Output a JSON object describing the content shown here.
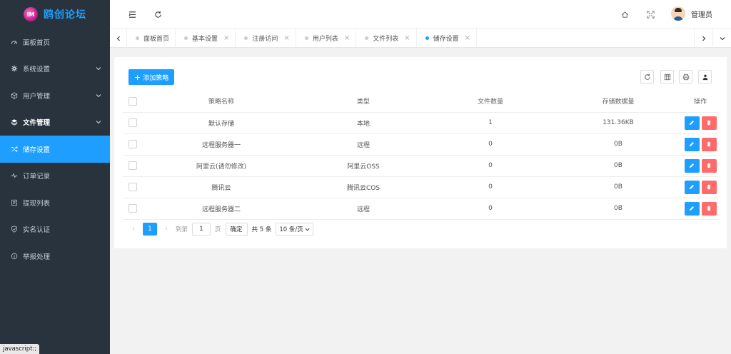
{
  "brand": {
    "name": "鸥创论坛",
    "mark": "IM"
  },
  "sidebar": {
    "items": [
      {
        "label": "面板首页",
        "icon": "dashboard-icon"
      },
      {
        "label": "系统设置",
        "icon": "gear-icon",
        "has_children": true
      },
      {
        "label": "用户管理",
        "icon": "cube-icon",
        "has_children": true
      },
      {
        "label": "文件管理",
        "icon": "layers-icon",
        "has_children": true
      },
      {
        "label": "储存设置",
        "icon": "shuffle-icon"
      },
      {
        "label": "订单记录",
        "icon": "pulse-icon"
      },
      {
        "label": "提现列表",
        "icon": "list-icon"
      },
      {
        "label": "实名认证",
        "icon": "shield-icon"
      },
      {
        "label": "举报处理",
        "icon": "info-icon"
      }
    ]
  },
  "status_bar": {
    "text": "javascript:;"
  },
  "header": {
    "user_name": "管理员"
  },
  "tabs": [
    {
      "label": "面板首页",
      "closable": false
    },
    {
      "label": "基本设置",
      "closable": true
    },
    {
      "label": "注册访问",
      "closable": true
    },
    {
      "label": "用户列表",
      "closable": true
    },
    {
      "label": "文件列表",
      "closable": true
    },
    {
      "label": "储存设置",
      "closable": true,
      "active": true
    }
  ],
  "toolbar": {
    "add_label": "添加策略"
  },
  "table": {
    "columns": [
      "策略名称",
      "类型",
      "文件数量",
      "存储数据量",
      "操作"
    ],
    "rows": [
      {
        "name": "默认存储",
        "type": "本地",
        "count": "1",
        "size": "131.36KB"
      },
      {
        "name": "远程服务器一",
        "type": "远程",
        "count": "0",
        "size": "0B"
      },
      {
        "name": "阿里云(请勿修改)",
        "type": "阿里云OSS",
        "count": "0",
        "size": "0B"
      },
      {
        "name": "腾讯云",
        "type": "腾讯云COS",
        "count": "0",
        "size": "0B"
      },
      {
        "name": "远程服务器二",
        "type": "远程",
        "count": "0",
        "size": "0B"
      }
    ]
  },
  "pager": {
    "current": "1",
    "goto_label": "到第",
    "goto_value": "1",
    "page_unit": "页",
    "confirm": "确定",
    "total": "共 5 条",
    "page_size": "10 条/页"
  },
  "colors": {
    "sidebar_bg": "#28333e",
    "accent": "#1e9fff",
    "danger": "#ff5c5c"
  }
}
